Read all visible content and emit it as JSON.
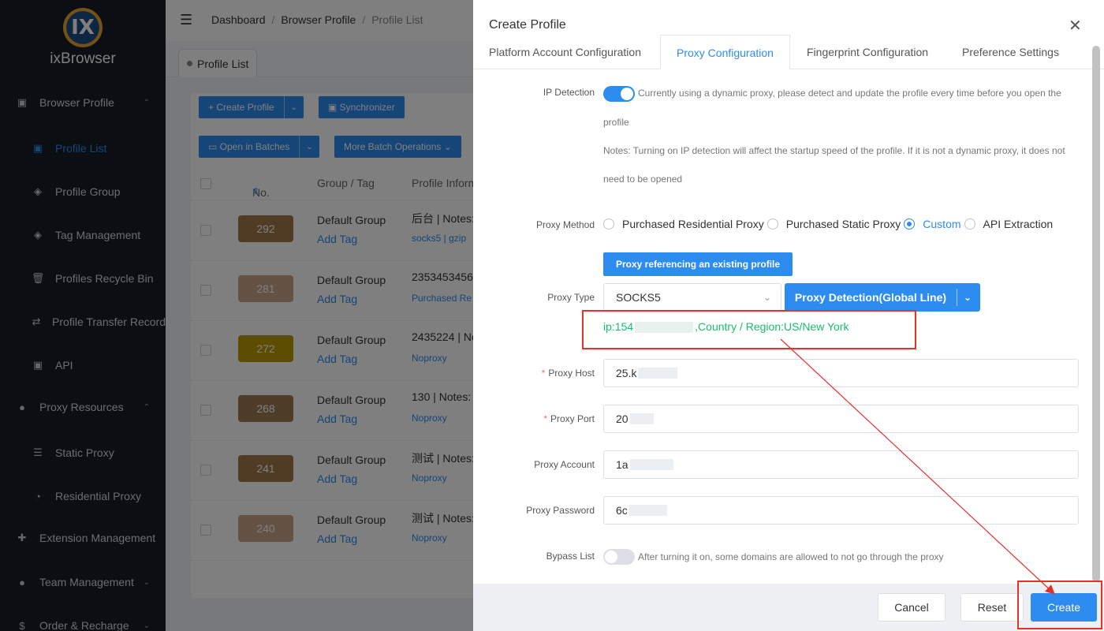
{
  "sidebar": {
    "brand": "ixBrowser",
    "logo_mark": "IX",
    "items": [
      {
        "label": "Browser Profile",
        "icon": "calendar-icon",
        "level": "top",
        "chevron": "⌃"
      },
      {
        "label": "Profile List",
        "icon": "calendar-icon",
        "level": "sub",
        "active": true
      },
      {
        "label": "Profile Group",
        "icon": "layers-icon",
        "level": "sub"
      },
      {
        "label": "Tag Management",
        "icon": "layers-icon",
        "level": "sub"
      },
      {
        "label": "Profiles Recycle Bin",
        "icon": "trash-icon",
        "level": "sub"
      },
      {
        "label": "Profile Transfer Record",
        "icon": "transfer-icon",
        "level": "sub"
      },
      {
        "label": "API",
        "icon": "calendar-icon",
        "level": "sub"
      },
      {
        "label": "Proxy Resources",
        "icon": "globe-icon",
        "level": "top",
        "chevron": "⌃"
      },
      {
        "label": "Static Proxy",
        "icon": "list-icon",
        "level": "sub"
      },
      {
        "label": "Residential Proxy",
        "icon": "gauge-icon",
        "level": "sub"
      },
      {
        "label": "Extension Management",
        "icon": "puzzle-icon",
        "level": "top"
      },
      {
        "label": "Team Management",
        "icon": "user-icon",
        "level": "top",
        "chevron": "⌄"
      },
      {
        "label": "Order & Recharge",
        "icon": "dollar-icon",
        "level": "top",
        "chevron": "⌄"
      }
    ]
  },
  "header": {
    "breadcrumb": [
      "Dashboard",
      "Browser Profile",
      "Profile List"
    ],
    "separator": "/"
  },
  "page_tab": {
    "label": "Profile List"
  },
  "toolbar": {
    "create_profile": "+ Create Profile",
    "synchronizer": "Synchronizer",
    "open_in_batches": "Open in Batches",
    "more_batch": "More Batch Operations"
  },
  "table": {
    "headers": [
      "No.",
      "Group / Tag",
      "Profile Informa"
    ],
    "rows": [
      {
        "no": "292",
        "color": "#a0784a",
        "group": "Default Group",
        "tag": "Add Tag",
        "info1": "后台 | Notes:",
        "info2": "socks5 | gzip"
      },
      {
        "no": "281",
        "color": "#c8a584",
        "group": "Default Group",
        "tag": "Add Tag",
        "info1": "2353453456",
        "info2": "Purchased Re"
      },
      {
        "no": "272",
        "color": "#b89a00",
        "group": "Default Group",
        "tag": "Add Tag",
        "info1": "2435224 | No",
        "info2": "Noproxy"
      },
      {
        "no": "268",
        "color": "#9c7a52",
        "group": "Default Group",
        "tag": "Add Tag",
        "info1": "130 | Notes:",
        "info2": "Noproxy"
      },
      {
        "no": "241",
        "color": "#a0784a",
        "group": "Default Group",
        "tag": "Add Tag",
        "info1": "测试 | Notes:",
        "info2": "Noproxy"
      },
      {
        "no": "240",
        "color": "#c8a584",
        "group": "Default Group",
        "tag": "Add Tag",
        "info1": "测试 | Notes:",
        "info2": "Noproxy"
      }
    ]
  },
  "drawer": {
    "title": "Create Profile",
    "tabs": [
      "Platform Account Configuration",
      "Proxy Configuration",
      "Fingerprint Configuration",
      "Preference Settings"
    ],
    "active_tab": 1,
    "ip_detection": {
      "label": "IP Detection",
      "on": true,
      "hint_line1": "Currently using a dynamic proxy, please detect and update the profile every time before you open the",
      "hint_line2": "profile",
      "hint_line3": "Notes: Turning on IP detection will affect the startup speed of the profile. If it is not a dynamic proxy, it does not",
      "hint_line4": "need to be opened"
    },
    "proxy_method": {
      "label": "Proxy Method",
      "options": [
        "Purchased Residential Proxy",
        "Purchased Static Proxy",
        "Custom",
        "API Extraction"
      ],
      "selected": "Custom"
    },
    "ref_button": "Proxy referencing an existing profile",
    "proxy_type": {
      "label": "Proxy Type",
      "value": "SOCKS5"
    },
    "detect_button": "Proxy Detection(Global Line)",
    "ip_result": {
      "prefix": "ip:154",
      "suffix": ",Country / Region:US/New York"
    },
    "proxy_host": {
      "label": "Proxy Host",
      "value": "25.k"
    },
    "proxy_port": {
      "label": "Proxy Port",
      "value": "20"
    },
    "proxy_account": {
      "label": "Proxy Account",
      "value": "1a"
    },
    "proxy_password": {
      "label": "Proxy Password",
      "value": "6c"
    },
    "bypass": {
      "label": "Bypass List",
      "on": false,
      "hint": "After turning it on, some domains are allowed to not go through the proxy"
    },
    "footer": {
      "cancel": "Cancel",
      "reset": "Reset",
      "create": "Create"
    }
  },
  "colors": {
    "accent": "#2d8cf0",
    "success": "#19be6b",
    "annotation": "#e5302b",
    "sidebar_bg": "#171d25"
  }
}
